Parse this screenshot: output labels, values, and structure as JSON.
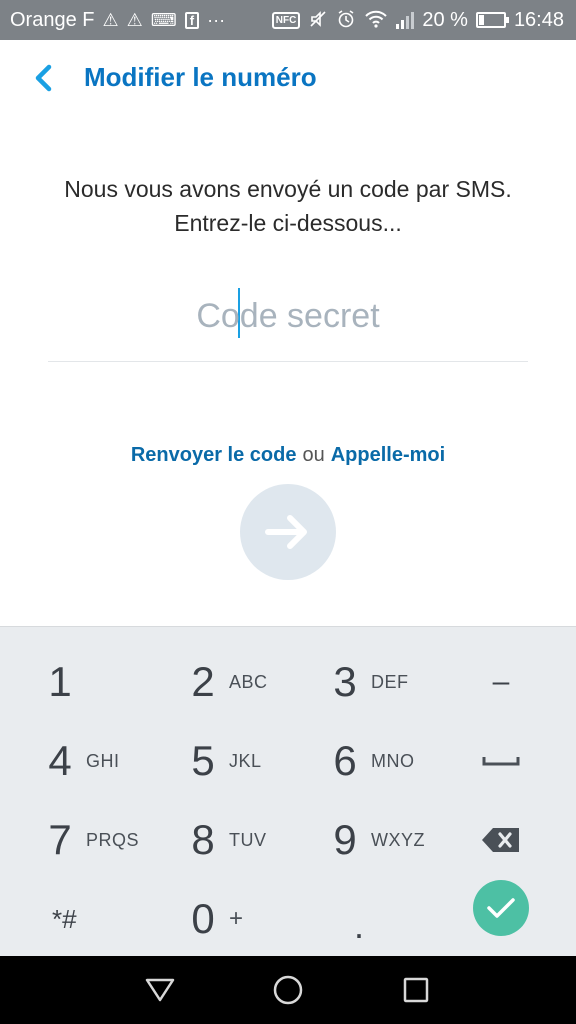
{
  "status_bar": {
    "carrier": "Orange F",
    "battery": "20 %",
    "time": "16:48",
    "nfc_label": "NFC",
    "icons": [
      "warning-icon",
      "warning-icon",
      "keyboard-icon",
      "facebook-icon",
      "more-icon",
      "nfc-icon",
      "mute-icon",
      "alarm-icon",
      "wifi-icon",
      "signal-icon",
      "battery-icon"
    ]
  },
  "header": {
    "title": "Modifier le numéro",
    "back_icon": "chevron-left-icon"
  },
  "instructions": {
    "line1": "Nous vous avons envoyé un code par SMS.",
    "line2": "Entrez-le ci-dessous..."
  },
  "code_input": {
    "placeholder": "Code secret",
    "value": ""
  },
  "links": {
    "resend": "Renvoyer le code",
    "separator": "ou",
    "call": "Appelle-moi"
  },
  "keypad": {
    "keys": [
      {
        "num": "1",
        "letters": ""
      },
      {
        "num": "2",
        "letters": "ABC"
      },
      {
        "num": "3",
        "letters": "DEF"
      },
      {
        "num": "–",
        "letters": ""
      },
      {
        "num": "4",
        "letters": "GHI"
      },
      {
        "num": "5",
        "letters": "JKL"
      },
      {
        "num": "6",
        "letters": "MNO"
      },
      {
        "num": "␣",
        "letters": ""
      },
      {
        "num": "7",
        "letters": "PRQS"
      },
      {
        "num": "8",
        "letters": "TUV"
      },
      {
        "num": "9",
        "letters": "WXYZ"
      },
      {
        "num": "*#",
        "letters": ""
      },
      {
        "num": "0",
        "letters": "+"
      },
      {
        "num": ".",
        "letters": ""
      }
    ]
  },
  "colors": {
    "accent": "#0a75c2",
    "link": "#0a6aa8",
    "done": "#4dc0a4",
    "keypad_bg": "#e9ecef",
    "status_bar_bg": "#7d8287"
  }
}
